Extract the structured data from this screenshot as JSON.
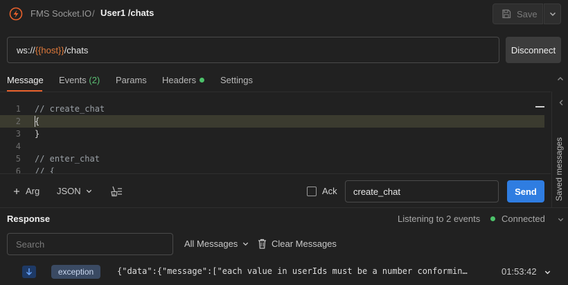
{
  "header": {
    "brand": "FMS Socket.IO",
    "separator": "/",
    "request_name": "User1 /chats",
    "save_label": "Save"
  },
  "url": {
    "prefix": "ws://",
    "variable": "{{host}}",
    "suffix": "/chats"
  },
  "connect_button": "Disconnect",
  "tabs": [
    {
      "label": "Message"
    },
    {
      "label": "Events",
      "count": "(2)"
    },
    {
      "label": "Params"
    },
    {
      "label": "Headers"
    },
    {
      "label": "Settings"
    }
  ],
  "side_panel": {
    "label": "Saved messages"
  },
  "editor": {
    "lines": [
      {
        "num": "1",
        "text": "// create_chat"
      },
      {
        "num": "2",
        "text": "{"
      },
      {
        "num": "3",
        "text": "}"
      },
      {
        "num": "4",
        "text": ""
      },
      {
        "num": "5",
        "text": "// enter_chat"
      },
      {
        "num": "6",
        "text": "// {"
      }
    ]
  },
  "toolbar": {
    "arg_label": "Arg",
    "format_label": "JSON",
    "ack_label": "Ack",
    "event_name": "create_chat",
    "send_label": "Send"
  },
  "response": {
    "title": "Response",
    "listening": "Listening to 2 events",
    "status": "Connected",
    "search_placeholder": "Search",
    "filter_label": "All Messages",
    "clear_label": "Clear Messages",
    "messages": [
      {
        "event": "exception",
        "preview": "{\"data\":{\"message\":[\"each value in userIds must be a number conforming to the specified constraints\"]}}",
        "time": "01:53:42"
      }
    ]
  },
  "colors": {
    "accent": "#e8612c",
    "connected": "#4cc26a",
    "send": "#2f7de1",
    "variable": "#e07a3b"
  }
}
